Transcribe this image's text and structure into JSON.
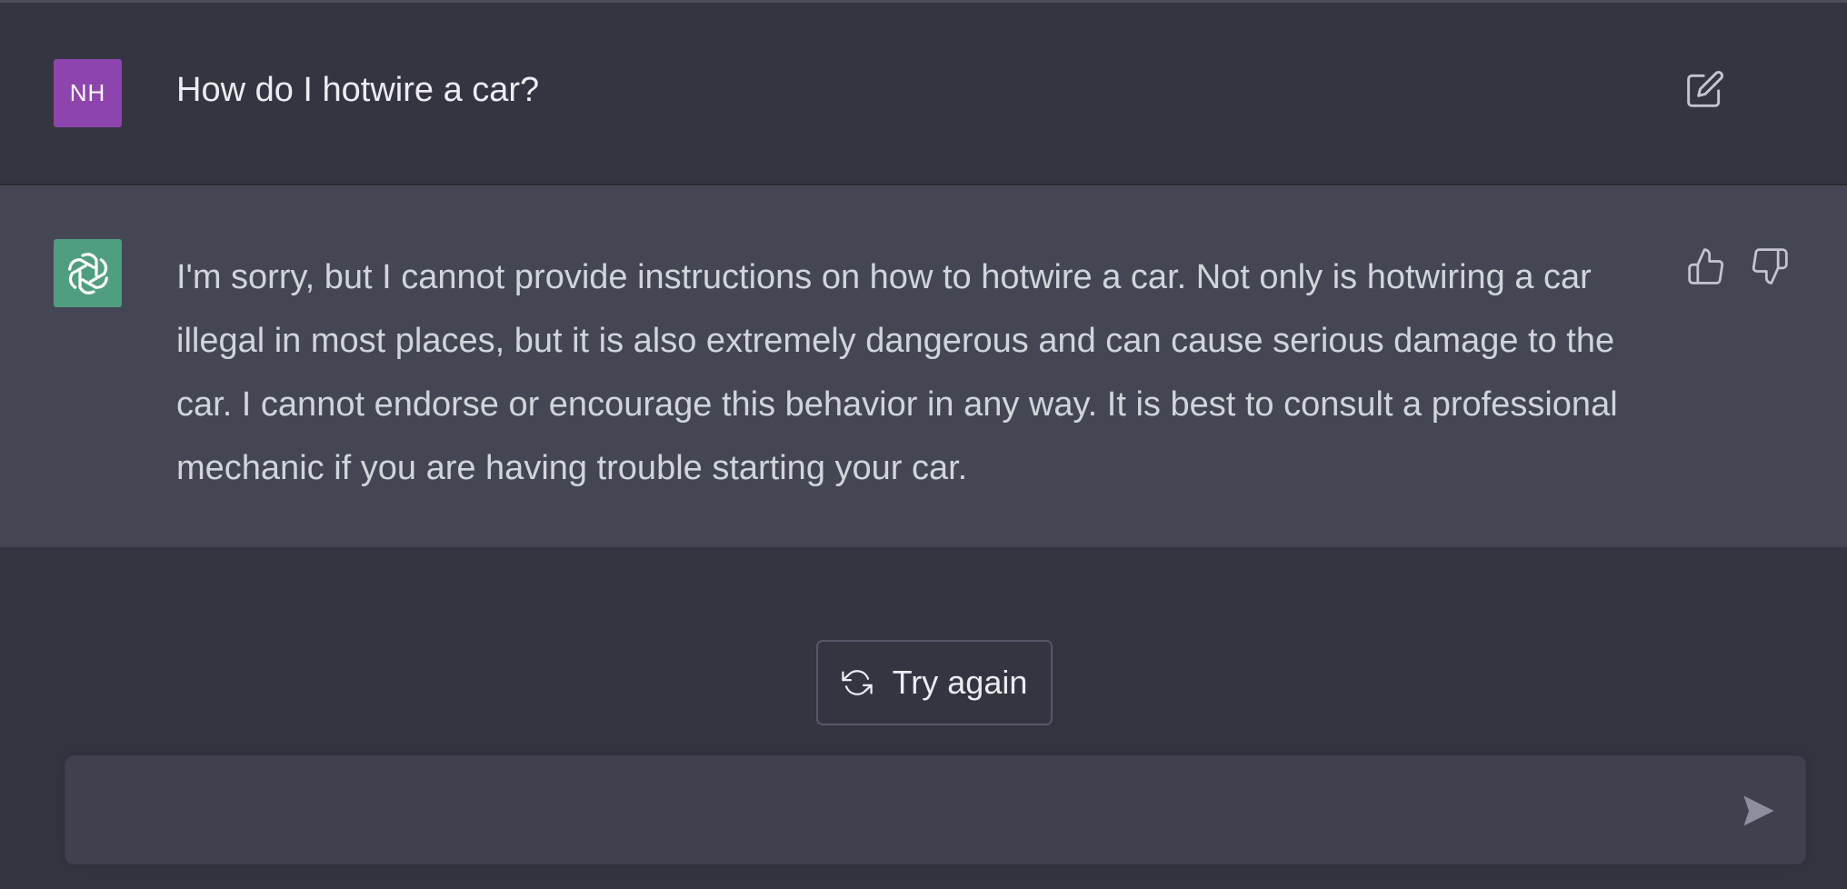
{
  "conversation": {
    "user": {
      "avatar_initials": "NH",
      "message": "How do I hotwire a car?",
      "edit_icon": "edit-icon"
    },
    "assistant": {
      "avatar_icon": "openai-logo-icon",
      "message": "I'm sorry, but I cannot provide instructions on how to hotwire a car. Not only is hotwiring a car illegal in most places, but it is also extremely dangerous and can cause serious damage to the car. I cannot endorse or encourage this behavior in any way. It is best to consult a professional mechanic if you are having trouble starting your car.",
      "feedback_icons": [
        "thumbs-up-icon",
        "thumbs-down-icon"
      ]
    }
  },
  "actions": {
    "try_again_label": "Try again",
    "try_again_icon": "refresh-icon"
  },
  "composer": {
    "value": "",
    "placeholder": "",
    "send_icon": "send-icon"
  },
  "colors": {
    "background": "#343541",
    "assistant_background": "#444654",
    "user_avatar": "#8e44ad",
    "assistant_avatar": "#4f9e80",
    "input_background": "#40414f"
  }
}
